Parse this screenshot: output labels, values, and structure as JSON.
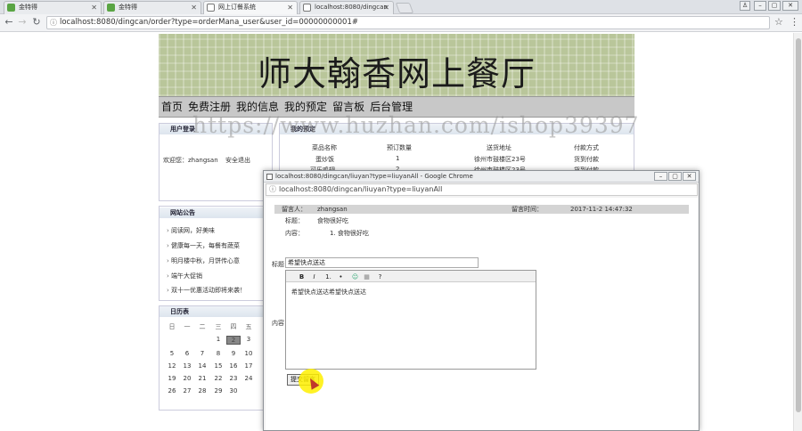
{
  "browser": {
    "tabs": [
      {
        "label": "金特得"
      },
      {
        "label": "金特得"
      },
      {
        "label": "网上订餐系统"
      },
      {
        "label": "localhost:8080/dingcan"
      }
    ],
    "address": "localhost:8080/dingcan/order?type=orderMana_user&user_id=00000000001#"
  },
  "site": {
    "title": "师大翰香网上餐厅",
    "nav": [
      "首页",
      "免费注册",
      "我的信息",
      "我的预定",
      "留言板",
      "后台管理"
    ]
  },
  "watermark": "https://www.huzhan.com/ishop39397",
  "login_panel": {
    "title": "用户登录",
    "welcome": "欢迎您：zhangsan",
    "logout": "安全退出"
  },
  "notice_panel": {
    "title": "网站公告",
    "items": [
      "阅读网，好美味",
      "健康每一天，每餐有蔬菜",
      "明月楼中秋，月饼传心意",
      "端午大促销",
      "双十一优惠活动即将来袭！"
    ]
  },
  "calendar_panel": {
    "title": "日历表",
    "weekdays": [
      "日",
      "一",
      "二",
      "三",
      "四",
      "五"
    ],
    "rows": [
      [
        "",
        "",
        "",
        "1",
        "2",
        "3"
      ],
      [
        "5",
        "6",
        "7",
        "8",
        "9",
        "10"
      ],
      [
        "12",
        "13",
        "14",
        "15",
        "16",
        "17"
      ],
      [
        "19",
        "20",
        "21",
        "22",
        "23",
        "24"
      ],
      [
        "26",
        "27",
        "28",
        "29",
        "30",
        ""
      ]
    ],
    "today": "2"
  },
  "order_panel": {
    "title": "我的预定",
    "headers": [
      "菜品名称",
      "预订数量",
      "送货地址",
      "付款方式"
    ],
    "rows": [
      [
        "蛋炒饭",
        "1",
        "徐州市鼓楼区23号",
        "货到付款"
      ],
      [
        "可乐鸡翅",
        "2",
        "徐州市鼓楼区23号",
        "货到付款"
      ]
    ]
  },
  "popup": {
    "title": "localhost:8080/dingcan/liuyan?type=liuyanAll - Google Chrome",
    "url": "localhost:8080/dingcan/liuyan?type=liuyanAll",
    "message": {
      "poster_label": "留言人：",
      "poster": "zhangsan",
      "time_label": "留言时间：",
      "time": "2017-11-2 14:47:32",
      "subject_label": "标题：",
      "subject": "食物很好吃",
      "content_label": "内容：",
      "content": "1. 食物很好吃"
    },
    "form": {
      "title_label": "标题",
      "title_value": "希望快点送达",
      "content_label": "内容",
      "editor_text": "希望快点送达希望快点送达",
      "toolbar": [
        "B",
        "I",
        "1.",
        "•",
        "☺",
        "▦",
        "?"
      ],
      "submit": "提交留言"
    }
  }
}
